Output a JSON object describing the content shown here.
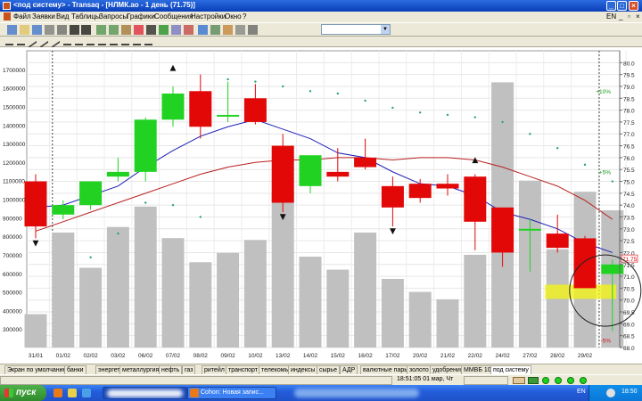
{
  "window": {
    "title": "<под систему> - Transaq - [НЛМК.ao - 1 день (71.75)]",
    "minimize": "_",
    "maximize": "□",
    "close": "×"
  },
  "menu": {
    "items": [
      "Файл",
      "Заявки",
      "Вид",
      "Таблицы",
      "Запросы",
      "Графики",
      "Сообщения",
      "Настройки",
      "Окно",
      "?"
    ],
    "language": "EN"
  },
  "toolbar": {
    "icons": [
      "new-icon",
      "open-icon",
      "save-icon",
      "print-icon",
      "cut-icon",
      "back-arrow-icon",
      "forward-arrow-icon",
      "copy-icon",
      "paste-icon",
      "find-icon",
      "red-alert-icon",
      "sum-icon",
      "dollar-icon",
      "function-icon",
      "order-icon",
      "chart-icon",
      "table-icon",
      "filter-icon",
      "settings-icon",
      "help-icon"
    ],
    "combo_value": ""
  },
  "draw_toolbar": {
    "icons": [
      "cursor-icon",
      "plus-icon",
      "line-icon",
      "ray-icon",
      "diagonal-icon",
      "channel-icon",
      "fibonacci-icon",
      "text-icon",
      "rectangle-icon",
      "ellipse-icon",
      "arrow-icon",
      "grid-icon",
      "zoom-icon"
    ]
  },
  "chart_data": {
    "type": "candlestick",
    "instrument": "НЛМК.ao",
    "timeframe": "1 день",
    "last_price": 71.75,
    "categories": [
      "31/01",
      "01/02",
      "02/02",
      "03/02",
      "06/02",
      "07/02",
      "08/02",
      "09/02",
      "10/02",
      "13/02",
      "14/02",
      "15/02",
      "16/02",
      "17/02",
      "20/02",
      "21/02",
      "22/02",
      "24/02",
      "27/02",
      "28/02",
      "29/02",
      ""
    ],
    "candles": [
      {
        "o": 75.0,
        "h": 75.3,
        "l": 72.6,
        "c": 73.1
      },
      {
        "o": 73.6,
        "h": 74.2,
        "l": 73.4,
        "c": 74.0
      },
      {
        "o": 74.0,
        "h": 75.0,
        "l": 73.8,
        "c": 75.0
      },
      {
        "o": 75.2,
        "h": 76.0,
        "l": 75.0,
        "c": 75.4
      },
      {
        "o": 75.4,
        "h": 77.7,
        "l": 75.0,
        "c": 77.6
      },
      {
        "o": 77.6,
        "h": 79.0,
        "l": 77.3,
        "c": 78.7
      },
      {
        "o": 78.8,
        "h": 79.5,
        "l": 76.8,
        "c": 77.3
      },
      {
        "o": 77.8,
        "h": 79.2,
        "l": 77.5,
        "c": 77.8
      },
      {
        "o": 78.5,
        "h": 79.1,
        "l": 77.4,
        "c": 77.5
      },
      {
        "o": 76.5,
        "h": 77.0,
        "l": 73.7,
        "c": 74.1
      },
      {
        "o": 74.8,
        "h": 76.0,
        "l": 74.5,
        "c": 76.1
      },
      {
        "o": 75.4,
        "h": 76.4,
        "l": 75.0,
        "c": 75.2
      },
      {
        "o": 76.0,
        "h": 76.8,
        "l": 75.5,
        "c": 75.6
      },
      {
        "o": 74.8,
        "h": 75.2,
        "l": 73.1,
        "c": 73.9
      },
      {
        "o": 74.9,
        "h": 75.1,
        "l": 74.1,
        "c": 74.3
      },
      {
        "o": 74.9,
        "h": 75.3,
        "l": 74.4,
        "c": 74.7
      },
      {
        "o": 75.2,
        "h": 75.3,
        "l": 72.1,
        "c": 73.3
      },
      {
        "o": 73.9,
        "h": 73.9,
        "l": 71.4,
        "c": 72.0
      },
      {
        "o": 73.0,
        "h": 73.4,
        "l": 71.2,
        "c": 73.0
      },
      {
        "o": 72.8,
        "h": 73.6,
        "l": 72.0,
        "c": 72.2
      },
      {
        "o": 72.6,
        "h": 72.7,
        "l": 70.7,
        "c": 70.5
      },
      {
        "o": 71.1,
        "h": 71.7,
        "l": 68.7,
        "c": 71.5
      }
    ],
    "volume_left_axis": [
      380000,
      820000,
      630000,
      850000,
      960000,
      790000,
      660000,
      710000,
      780000,
      1040000,
      690000,
      620000,
      820000,
      570000,
      500000,
      460000,
      700000,
      1630000,
      1100000,
      730000,
      1040000,
      940000
    ],
    "ma_fast": [
      73.9,
      74.0,
      74.4,
      74.8,
      75.6,
      76.3,
      76.9,
      77.3,
      77.6,
      77.2,
      76.8,
      76.2,
      76.0,
      75.4,
      74.9,
      74.8,
      74.4,
      73.7,
      73.4,
      73.0,
      72.4,
      72.0
    ],
    "ma_slow": [
      72.9,
      73.3,
      73.7,
      74.1,
      74.5,
      74.9,
      75.3,
      75.6,
      75.8,
      75.9,
      75.9,
      76.0,
      76.0,
      75.9,
      76.0,
      76.0,
      75.9,
      75.6,
      75.2,
      74.8,
      74.2,
      73.4
    ],
    "sar_dots": [
      null,
      null,
      71.8,
      72.8,
      74.1,
      74.0,
      73.5,
      79.3,
      79.2,
      79.0,
      78.8,
      78.7,
      78.4,
      78.1,
      77.9,
      77.8,
      77.7,
      77.5,
      77.0,
      76.4,
      75.7,
      75.0
    ],
    "signals": [
      {
        "index": 0,
        "kind": "down",
        "price": 72.3
      },
      {
        "index": 5,
        "kind": "up",
        "price": 79.7
      },
      {
        "index": 9,
        "kind": "down",
        "price": 73.4
      },
      {
        "index": 13,
        "kind": "down",
        "price": 72.8
      },
      {
        "index": 16,
        "kind": "up",
        "price": 75.8
      }
    ],
    "right_axis": {
      "min": 68.0,
      "max": 80.5,
      "ticks": [
        80.0,
        79.5,
        79.0,
        78.5,
        78.0,
        77.5,
        77.0,
        76.5,
        76.0,
        75.5,
        75.0,
        74.5,
        74.0,
        73.5,
        73.0,
        72.5,
        72.0,
        71.5,
        71.0,
        70.5,
        70.0,
        69.5,
        69.0,
        68.5,
        68.0
      ],
      "highlight": "71.75"
    },
    "left_axis": {
      "min": 200000,
      "max": 1800000,
      "ticks": [
        1700000,
        1600000,
        1500000,
        1400000,
        1300000,
        1200000,
        1100000,
        1000000,
        900000,
        800000,
        700000,
        600000,
        500000,
        400000,
        300000
      ]
    },
    "percent_labels": [
      {
        "text": "+10%",
        "price": 78.7,
        "color": "#1a9a1a"
      },
      {
        "text": "+5%",
        "price": 75.3,
        "color": "#1a9a1a"
      },
      {
        "text": "-5%",
        "price": 68.2,
        "color": "#d11a1a"
      }
    ],
    "colors": {
      "up": "#22d222",
      "down": "#e20808",
      "volume": "#c0c0c0",
      "ma_fast": "#1f1fb8",
      "ma_slow": "#b81f1f",
      "sar": "#2aa07a",
      "highlight_band": "#f2f21a"
    }
  },
  "tabs": [
    "Экран по умолчанию",
    "банки",
    "энергетика",
    "металлургия",
    "нефть",
    "газ",
    "ритейл",
    "транспорт",
    "телекомы",
    "индексы",
    "сырье",
    "АДР",
    "валютные пары",
    "золото",
    "удобрения",
    "ММВБ 10",
    "под систему"
  ],
  "active_tab": 16,
  "status": {
    "time": "18:51:05  01 мар, Чт"
  },
  "taskbar": {
    "start_label": "пуск",
    "task_button_2": "Соhon: Новая запис...",
    "language": "EN",
    "clock": "18:50"
  }
}
